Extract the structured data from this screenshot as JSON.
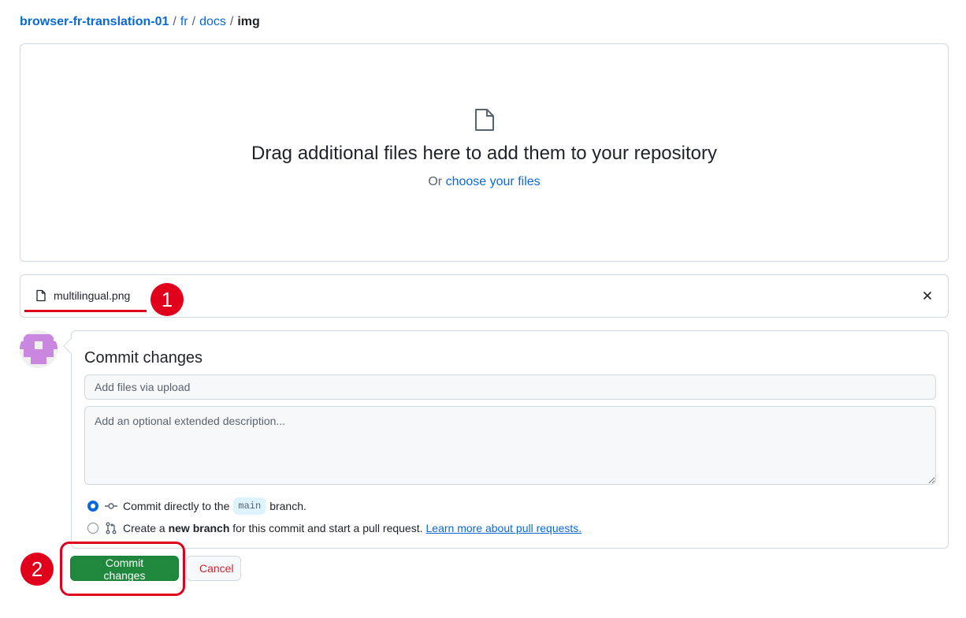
{
  "breadcrumb": {
    "repo": "browser-fr-translation-01",
    "sep": "/",
    "path1": "fr",
    "path2": "docs",
    "current": "img"
  },
  "dropzone": {
    "title": "Drag additional files here to add them to your repository",
    "or_text": "Or",
    "choose_link": "choose your files"
  },
  "uploaded_file": {
    "name": "multilingual.png"
  },
  "annotations": {
    "callout_1": "1",
    "callout_2": "2",
    "accent_color": "#e0001b"
  },
  "commit": {
    "heading": "Commit changes",
    "summary_placeholder": "Add files via upload",
    "description_placeholder": "Add an optional extended description...",
    "option_direct": {
      "prefix": "Commit directly to the",
      "branch": "main",
      "suffix": "branch.",
      "selected": true
    },
    "option_new_branch": {
      "prefix": "Create a",
      "bold": "new branch",
      "suffix": "for this commit and start a pull request.",
      "link": "Learn more about pull requests.",
      "selected": false
    }
  },
  "buttons": {
    "commit": "Commit changes",
    "cancel": "Cancel"
  },
  "colors": {
    "primary_button": "#1f883d",
    "link": "#0969da",
    "cancel_text": "#d1242f"
  }
}
